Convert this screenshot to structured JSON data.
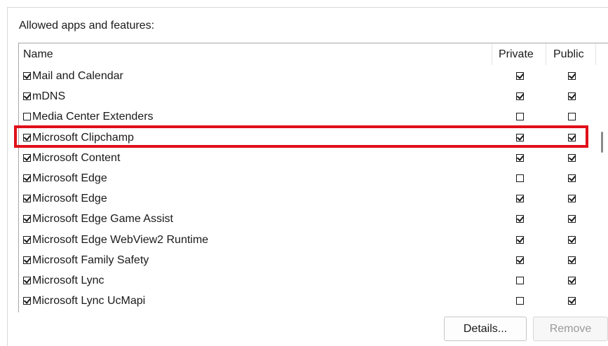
{
  "group_label": "Allowed apps and features:",
  "columns": {
    "name": "Name",
    "private": "Private",
    "public": "Public"
  },
  "rows": [
    {
      "name": "Mail and Calendar",
      "enabled": true,
      "private": true,
      "public": true
    },
    {
      "name": "mDNS",
      "enabled": true,
      "private": true,
      "public": true
    },
    {
      "name": "Media Center Extenders",
      "enabled": false,
      "private": false,
      "public": false
    },
    {
      "name": "Microsoft Clipchamp",
      "enabled": true,
      "private": true,
      "public": true,
      "highlighted": true
    },
    {
      "name": "Microsoft Content",
      "enabled": true,
      "private": true,
      "public": true
    },
    {
      "name": "Microsoft Edge",
      "enabled": true,
      "private": false,
      "public": true
    },
    {
      "name": "Microsoft Edge",
      "enabled": true,
      "private": true,
      "public": true
    },
    {
      "name": "Microsoft Edge Game Assist",
      "enabled": true,
      "private": true,
      "public": true
    },
    {
      "name": "Microsoft Edge WebView2 Runtime",
      "enabled": true,
      "private": true,
      "public": true
    },
    {
      "name": "Microsoft Family Safety",
      "enabled": true,
      "private": true,
      "public": true
    },
    {
      "name": "Microsoft Lync",
      "enabled": true,
      "private": false,
      "public": true
    },
    {
      "name": "Microsoft Lync UcMapi",
      "enabled": true,
      "private": false,
      "public": true
    }
  ],
  "buttons": {
    "details": "Details...",
    "remove": "Remove"
  },
  "colors": {
    "highlight": "#e0101a"
  }
}
